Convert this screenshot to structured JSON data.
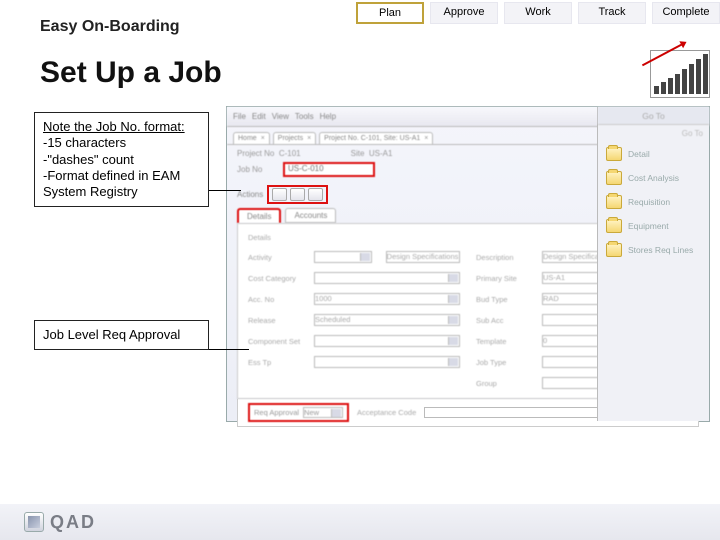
{
  "steps": [
    "Plan",
    "Approve",
    "Work",
    "Track",
    "Complete"
  ],
  "active_step": 0,
  "brand": "Easy On-Boarding",
  "title": "Set Up a Job",
  "callout1": {
    "head": "Note the Job No. format:",
    "b1": "-15 characters",
    "b2": "-\"dashes\" count",
    "b3": "-Format defined in EAM System Registry"
  },
  "callout2": "Job Level Req Approval",
  "app": {
    "toolbar": [
      "File",
      "Edit",
      "View",
      "Tools",
      "Help"
    ],
    "tabs": [
      "Home",
      "Projects",
      "Project No. C-101, Site: US-A1"
    ],
    "head_l_label": "Project No",
    "head_l_value": "C-101",
    "head_r_label": "Site",
    "head_r_value": "US-A1",
    "job_label": "Job No",
    "job_value": "US-C-010",
    "actions_label": "Actions",
    "subtab1": "Details",
    "subtab2": "Accounts",
    "grid": {
      "details": "Details",
      "activity": "Activity",
      "design": "Design",
      "design_spec": "Design Specifications",
      "cost_cat": "Cost Category",
      "acc_no": "Acc. No",
      "acc_val": "1000",
      "release": "Release",
      "rel_val": "Scheduled",
      "comp_set": "Component Set",
      "ess_tp": "Ess Tp",
      "description": "Description",
      "desc_val": "Design Specifications",
      "primary_site": "Primary Site",
      "psite_val": "US-A1",
      "bud_type": "Bud Type",
      "bud_val": "RAD",
      "sub_acc": "Sub Acc",
      "template": "Template",
      "tmpl_val": "0",
      "job_type": "Job Type",
      "group": "Group"
    },
    "req": {
      "f1_label": "Req Approval",
      "f1_value": "New",
      "f2_label": "Acceptance Code"
    },
    "side": {
      "tablike": "Go To",
      "hdr": "Go To",
      "items": [
        "Detail",
        "Cost Analysis",
        "Requisition",
        "Equipment",
        "Stores Req Lines"
      ]
    }
  },
  "footer_logo": "QAD"
}
